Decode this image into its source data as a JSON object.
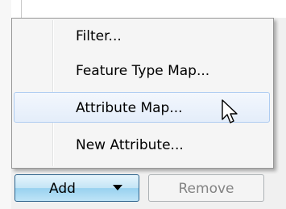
{
  "menu": {
    "items": [
      {
        "label": "Filter..."
      },
      {
        "label": "Feature Type Map..."
      },
      {
        "label": "Attribute Map..."
      },
      {
        "label": "New Attribute..."
      }
    ],
    "hovered_index": 2
  },
  "buttons": {
    "add_label": "Add",
    "remove_label": "Remove"
  },
  "icons": {
    "add_dropdown": "chevron-down-icon",
    "cursor": "mouse-pointer-icon"
  }
}
